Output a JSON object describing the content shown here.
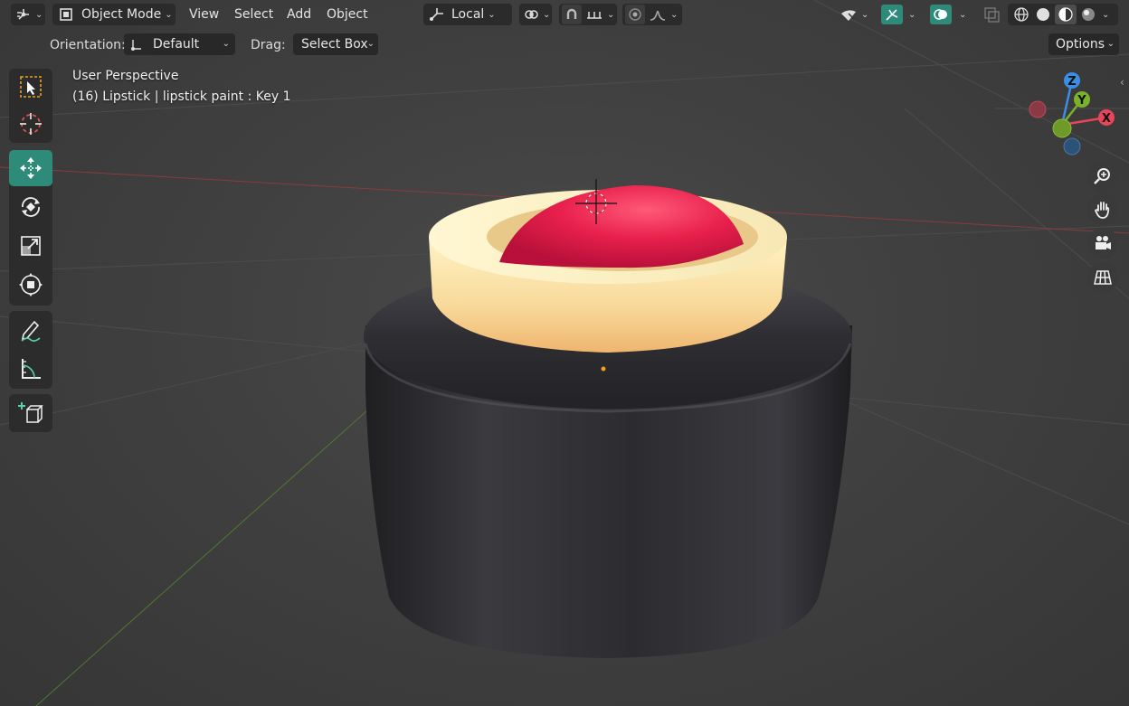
{
  "header": {
    "editor_type_icon": "axis-grid-icon",
    "mode": {
      "label": "Object Mode",
      "icon": "object-mode-icon"
    },
    "menus": [
      "View",
      "Select",
      "Add",
      "Object"
    ],
    "transform_orientation": {
      "label": "Local",
      "icon": "local-orientation-icon"
    },
    "pivot_icon": "pivot-point-icon",
    "snap_icon": "magnet-icon",
    "snap_target_icon": "snap-increment-icon",
    "proportional_icon": "proportional-edit-icon",
    "falloff_icon": "falloff-curve-icon",
    "visibility_icon": "selectability-icon",
    "gizmo_icon": "gizmo-icon",
    "overlay_icon": "overlays-icon",
    "xray_icon": "xray-icon",
    "shading_modes": [
      "wireframe-shading-icon",
      "solid-shading-icon",
      "material-preview-icon",
      "rendered-shading-icon"
    ],
    "active_shading": 2
  },
  "tool_settings": {
    "orientation_label": "Orientation:",
    "orientation_value": "Default",
    "drag_label": "Drag:",
    "drag_value": "Select Box",
    "options_label": "Options"
  },
  "viewport": {
    "view_name": "User Perspective",
    "object_info": "(16) Lipstick | lipstick paint : Key 1"
  },
  "toolbar": {
    "tools": [
      {
        "name": "select-box-icon",
        "active": false
      },
      {
        "name": "cursor-icon",
        "active": false
      },
      {
        "name": "move-icon",
        "active": true
      },
      {
        "name": "rotate-icon",
        "active": false
      },
      {
        "name": "scale-icon",
        "active": false
      },
      {
        "name": "transform-icon",
        "active": false
      },
      {
        "name": "annotate-icon",
        "active": false
      },
      {
        "name": "measure-icon",
        "active": false
      },
      {
        "name": "add-cube-icon",
        "active": false
      }
    ]
  },
  "gizmo": {
    "axes": [
      "X",
      "Y",
      "Z"
    ],
    "colors": {
      "x": "#e8445a",
      "y": "#7ab22a",
      "z": "#3a8ee6"
    }
  },
  "navigation": [
    "zoom-icon",
    "pan-hand-icon",
    "camera-view-icon",
    "ortho-grid-icon"
  ],
  "colors": {
    "accent": "#2e8b7a",
    "lipstick": "#e8204c",
    "ring": "#f7e3a4",
    "case": "#2a2a2e"
  }
}
